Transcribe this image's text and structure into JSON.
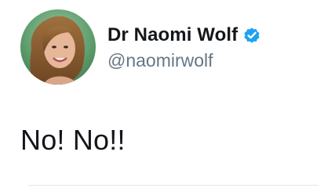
{
  "tweet": {
    "author": {
      "display_name": "Dr Naomi Wolf",
      "handle": "@naomirwolf",
      "verified": true,
      "avatar": "profile-photo"
    },
    "text": "No! No!!"
  },
  "icons": {
    "verified": "verified-badge-icon"
  },
  "colors": {
    "verified_badge": "#1da1f2",
    "name_text": "#14171a",
    "handle_text": "#657786",
    "divider": "#e1e8ed"
  }
}
